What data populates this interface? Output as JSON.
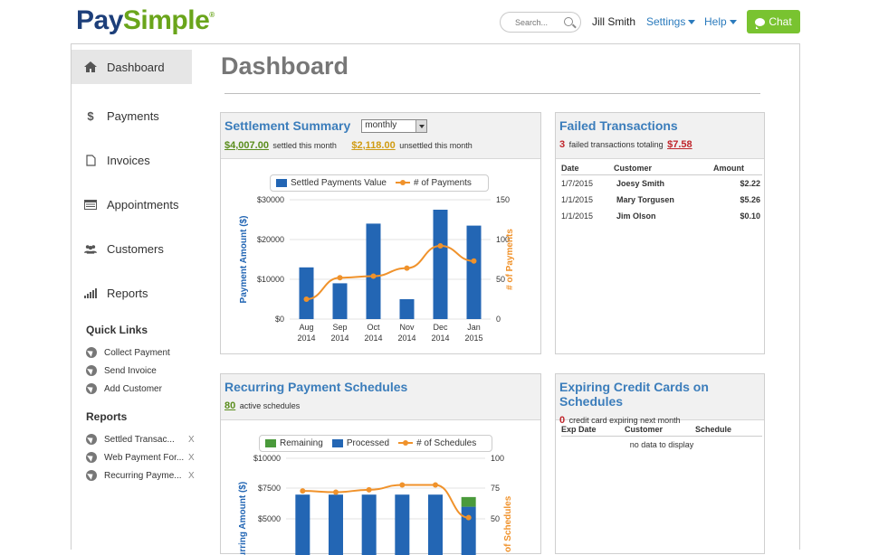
{
  "header": {
    "logo_pay": "Pay",
    "logo_simple": "Simple",
    "search_placeholder": "Search...",
    "user": "Jill Smith",
    "settings": "Settings",
    "help": "Help",
    "chat": "Chat"
  },
  "sidebar": {
    "items": [
      {
        "label": "Dashboard",
        "icon": "home-icon"
      },
      {
        "label": "Payments",
        "icon": "dollar-icon"
      },
      {
        "label": "Invoices",
        "icon": "document-icon"
      },
      {
        "label": "Appointments",
        "icon": "calendar-icon"
      },
      {
        "label": "Customers",
        "icon": "users-icon"
      },
      {
        "label": "Reports",
        "icon": "bar-chart-icon"
      }
    ],
    "quick_links_title": "Quick Links",
    "quick_links": [
      "Collect Payment",
      "Send Invoice",
      "Add Customer"
    ],
    "reports_title": "Reports",
    "reports": [
      "Settled Transac...",
      "Web Payment For...",
      "Recurring Payme..."
    ],
    "remove_label": "X"
  },
  "page": {
    "title": "Dashboard"
  },
  "settlement": {
    "title": "Settlement Summary",
    "period": "monthly",
    "settled_amount": "$4,007.00",
    "settled_text": "settled this month",
    "unsettled_amount": "$2,118.00",
    "unsettled_text": "unsettled this month"
  },
  "failed": {
    "title": "Failed Transactions",
    "count": "3",
    "text": "failed transactions totaling",
    "total": "$7.58",
    "columns": [
      "Date",
      "Customer",
      "Amount"
    ],
    "rows": [
      [
        "1/7/2015",
        "Joesy Smith",
        "$2.22"
      ],
      [
        "1/1/2015",
        "Mary Torgusen",
        "$5.26"
      ],
      [
        "1/1/2015",
        "Jim Olson",
        "$0.10"
      ]
    ]
  },
  "recurring": {
    "title": "Recurring Payment Schedules",
    "count": "80",
    "text": "active schedules"
  },
  "expiring": {
    "title": "Expiring Credit Cards on Schedules",
    "count": "0",
    "text": "credit card expiring next month",
    "columns": [
      "Exp Date",
      "Customer",
      "Schedule"
    ],
    "empty": "no data to display"
  },
  "colors": {
    "bar_blue": "#2366b4",
    "line_orange": "#f0922b",
    "remaining_green": "#4a9a3b",
    "title_blue": "#3b7dbb"
  },
  "chart_data": [
    {
      "type": "bar",
      "legend": [
        "Settled Payments Value",
        "# of Payments"
      ],
      "categories": [
        "Aug 2014",
        "Sep 2014",
        "Oct 2014",
        "Nov 2014",
        "Dec 2014",
        "Jan 2015"
      ],
      "series": [
        {
          "name": "Settled Payments Value",
          "values": [
            13000,
            9000,
            24000,
            5000,
            27500,
            23500
          ]
        },
        {
          "name": "# of Payments",
          "values": [
            25,
            52,
            54,
            64,
            92,
            73
          ]
        }
      ],
      "ylabel": "Payment Amount ($)",
      "y2label": "# of Payments",
      "ylim": [
        0,
        30000
      ],
      "y2lim": [
        0,
        150
      ],
      "yticks": [
        "$0",
        "$10000",
        "$20000",
        "$30000"
      ],
      "y2ticks": [
        "0",
        "50",
        "100",
        "150"
      ]
    },
    {
      "type": "bar",
      "legend": [
        "Remaining",
        "Processed",
        "# of Schedules"
      ],
      "categories": [
        "",
        "",
        "",
        "",
        "",
        ""
      ],
      "series": [
        {
          "name": "Processed",
          "values": [
            7000,
            7000,
            7000,
            7000,
            7000,
            6000
          ]
        },
        {
          "name": "Remaining",
          "values": [
            0,
            0,
            0,
            0,
            0,
            800
          ]
        },
        {
          "name": "# of Schedules",
          "values": [
            73,
            72,
            74,
            78,
            78,
            51
          ]
        }
      ],
      "ylabel": "Recurring Amount ($)",
      "y2label": "# of Schedules",
      "yticks": [
        "$5000",
        "$7500",
        "$10000"
      ],
      "y2ticks": [
        "50",
        "75",
        "100"
      ]
    }
  ]
}
